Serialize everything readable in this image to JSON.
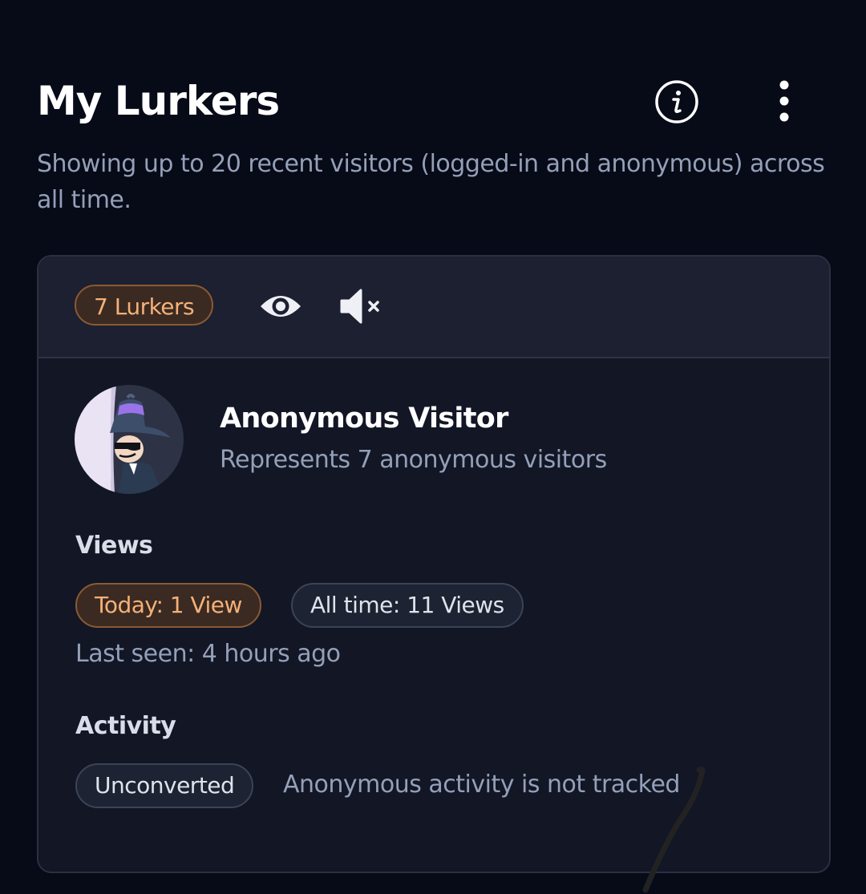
{
  "header": {
    "title": "My Lurkers",
    "subtitle": "Showing up to 20 recent visitors (logged-in and anonymous) across all time.",
    "info_icon": "info-circle-icon",
    "menu_icon": "more-vertical-icon"
  },
  "card": {
    "badge_label": "7 Lurkers",
    "eye_icon": "eye-icon",
    "mute_icon": "volume-mute-icon",
    "visitor": {
      "name": "Anonymous Visitor",
      "description": "Represents 7 anonymous visitors",
      "avatar_icon": "spy-avatar-icon"
    },
    "views": {
      "label": "Views",
      "today": "Today: 1 View",
      "all_time": "All time: 11 Views",
      "last_seen": "Last seen: 4 hours ago"
    },
    "activity": {
      "label": "Activity",
      "status": "Unconverted",
      "note": "Anonymous activity is not tracked"
    }
  },
  "colors": {
    "background": "#070a17",
    "card": "#121625",
    "card_header": "#1c2030",
    "accent_orange": "#f6b077",
    "muted_text": "#94a0b8"
  }
}
